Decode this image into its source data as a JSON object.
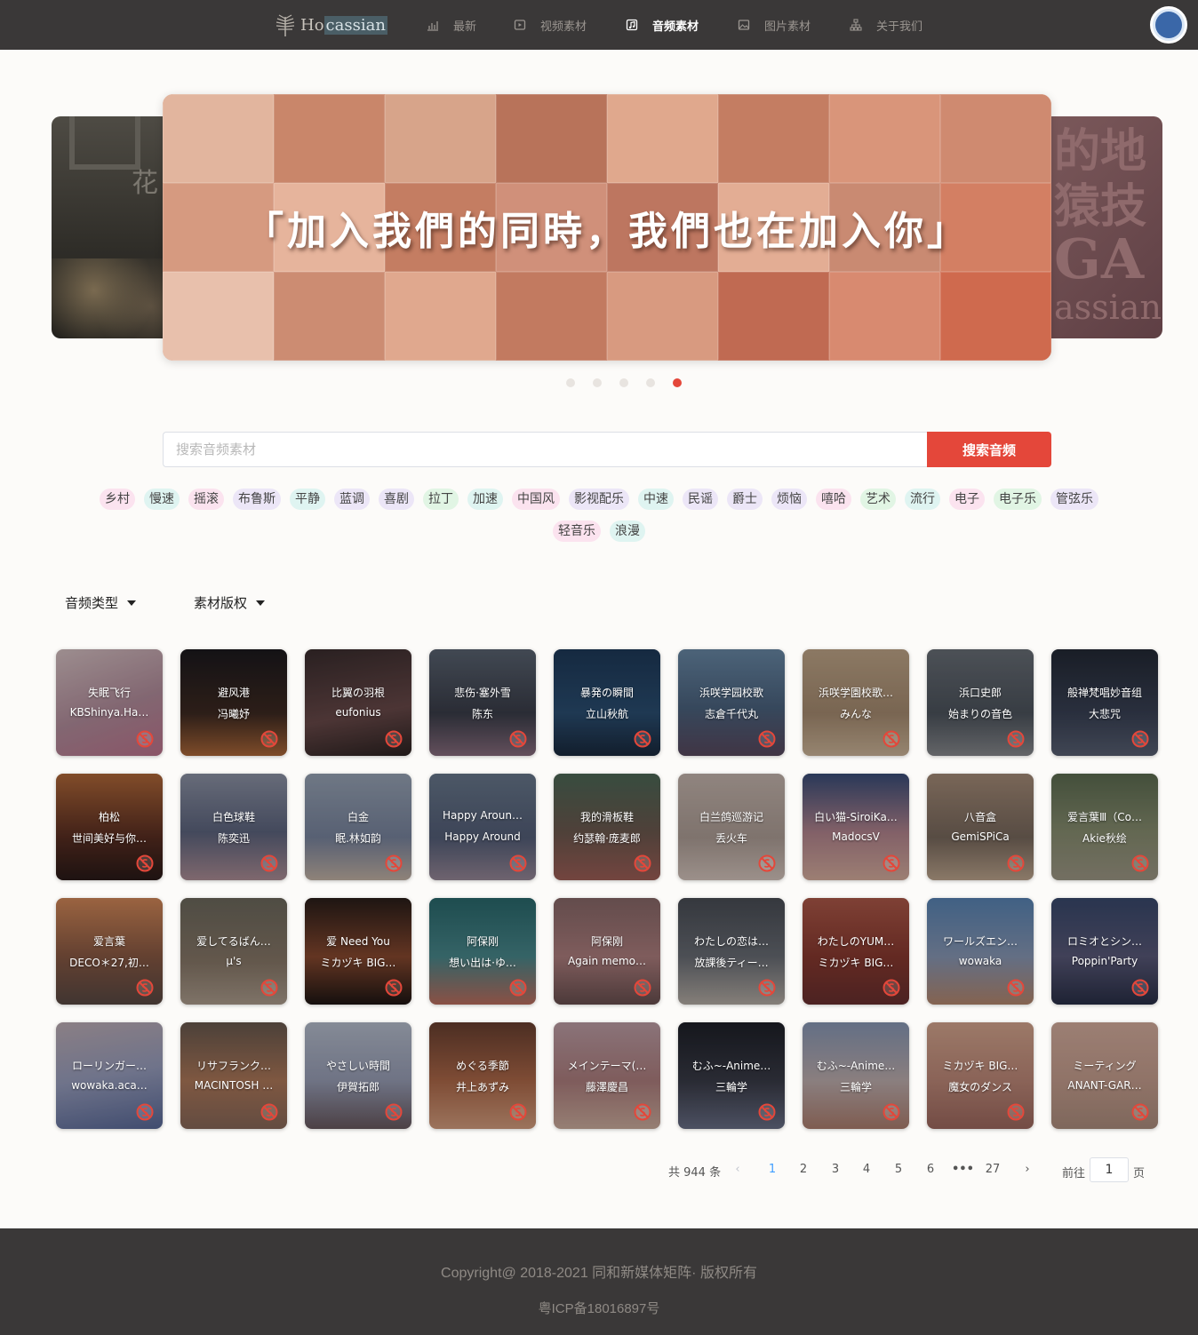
{
  "nav": {
    "logo_text_a": "Ho",
    "logo_text_b": "cassian",
    "items": [
      {
        "label": "最新",
        "icon": "bar-chart-icon"
      },
      {
        "label": "视频素材",
        "icon": "video-icon"
      },
      {
        "label": "音频素材",
        "icon": "music-icon"
      },
      {
        "label": "图片素材",
        "icon": "picture-icon"
      },
      {
        "label": "关于我们",
        "icon": "org-chart-icon"
      }
    ],
    "active_index": 2
  },
  "carousel": {
    "banner_text": "「加入我們的同時，我們也在加入你」",
    "left_slide_glyph": "花",
    "right_slide_lines": [
      "的地",
      "猿技",
      "GA",
      "assian"
    ],
    "dot_count": 5,
    "active_dot": 4
  },
  "search": {
    "placeholder": "搜索音频素材",
    "button_label": "搜索音频"
  },
  "tags": [
    {
      "label": "乡村",
      "color": "#fbe3ef"
    },
    {
      "label": "慢速",
      "color": "#dff4f1"
    },
    {
      "label": "摇滚",
      "color": "#fbe3ef"
    },
    {
      "label": "布鲁斯",
      "color": "#ece6f7"
    },
    {
      "label": "平静",
      "color": "#dff4f1"
    },
    {
      "label": "蓝调",
      "color": "#ece6f7"
    },
    {
      "label": "喜剧",
      "color": "#ece6f7"
    },
    {
      "label": "拉丁",
      "color": "#e1f5e4"
    },
    {
      "label": "加速",
      "color": "#dff4f1"
    },
    {
      "label": "中国风",
      "color": "#fbe3ef"
    },
    {
      "label": "影视配乐",
      "color": "#ece6f7"
    },
    {
      "label": "中速",
      "color": "#dff4f1"
    },
    {
      "label": "民谣",
      "color": "#ece6f7"
    },
    {
      "label": "爵士",
      "color": "#ece6f7"
    },
    {
      "label": "烦恼",
      "color": "#ece6f7"
    },
    {
      "label": "嘻哈",
      "color": "#fbe3ef"
    },
    {
      "label": "艺术",
      "color": "#e1f5e4"
    },
    {
      "label": "流行",
      "color": "#dff4f1"
    },
    {
      "label": "电子",
      "color": "#fbe3ef"
    },
    {
      "label": "电子乐",
      "color": "#e1f5e4"
    },
    {
      "label": "管弦乐",
      "color": "#ece6f7"
    },
    {
      "label": "轻音乐",
      "color": "#fbe3ef"
    },
    {
      "label": "浪漫",
      "color": "#dff4f1"
    }
  ],
  "filters": {
    "type_label": "音频类型",
    "license_label": "素材版权"
  },
  "cards": [
    {
      "title": "失眠飞行",
      "artist": "KBShinya.Ha…",
      "bg": "linear-gradient(160deg,#d9c4c6,#b58f9e 55%,#c07690)"
    },
    {
      "title": "避风港",
      "artist": "冯曦妤",
      "bg": "linear-gradient(180deg,#1c1a1e,#3e2a22 60%,#b06a3a)"
    },
    {
      "title": "比翼の羽根",
      "artist": "eufonius",
      "bg": "linear-gradient(170deg,#3a2d2e,#6a4a4a 60%,#2c2322)"
    },
    {
      "title": "悲伤·塞外雪",
      "artist": "陈东",
      "bg": "linear-gradient(180deg,#5b6573,#3b3e4a 60%,#8a6e80)"
    },
    {
      "title": "暴発の瞬間",
      "artist": "立山秋航",
      "bg": "linear-gradient(180deg,#1e3a5a,#2b4f73 60%,#1a2a3e)"
    },
    {
      "title": "浜咲学园校歌",
      "artist": "志倉千代丸",
      "bg": "linear-gradient(180deg,#6a8aa8,#4c6480 55%,#5a4a60)"
    },
    {
      "title": "浜咲学園校歌…",
      "artist": "みんな",
      "bg": "linear-gradient(180deg,#c2a88a,#a88d72 60%,#d1b99c)"
    },
    {
      "title": "浜口史郎",
      "artist": "始まりの音色",
      "bg": "linear-gradient(180deg,#6a7078,#4e555e 60%,#8a8c90)"
    },
    {
      "title": "般禅梵唱妙音组",
      "artist": "大悲咒",
      "bg": "linear-gradient(180deg,#242a36,#3a4256 60%,#5a6275)"
    },
    {
      "title": "柏松",
      "artist": "世间美好与你…",
      "bg": "linear-gradient(180deg,#b46a3a,#5a2e22 60%,#2a1a18)"
    },
    {
      "title": "白色球鞋",
      "artist": "陈奕迅",
      "bg": "linear-gradient(180deg,#8f95a8,#5e6680 55%,#b09098)"
    },
    {
      "title": "白金",
      "artist": "眠.林如韵",
      "bg": "linear-gradient(180deg,#9aa6b8,#7a86a0 60%,#c6b5a8)"
    },
    {
      "title": "Happy Aroun…",
      "artist": "Happy Around",
      "bg": "linear-gradient(180deg,#6a7a8e,#55607a 60%,#9a8a9a)"
    },
    {
      "title": "我的滑板鞋",
      "artist": "约瑟翰·庞麦郎",
      "bg": "linear-gradient(180deg,#4e6a58,#6e5a50 55%,#a06058)"
    },
    {
      "title": "白兰鸽巡游记",
      "artist": "丢火车",
      "bg": "linear-gradient(180deg,#c8b8b0,#b0a098 60%,#d8c8c0)"
    },
    {
      "title": "白い猫-SiroiKa…",
      "artist": "MadocsV",
      "bg": "linear-gradient(180deg,#3a4e7a,#b58690 55%,#d9b0a0)"
    },
    {
      "title": "八音盒",
      "artist": "GemiSPiCa",
      "bg": "linear-gradient(180deg,#a88e7a,#7a6a5e 60%,#c0a890)"
    },
    {
      "title": "爱言葉Ⅲ（Co…",
      "artist": "Akie秋绘",
      "bg": "linear-gradient(180deg,#5e6e52,#8a9072 55%,#a09a88)"
    },
    {
      "title": "爱言葉",
      "artist": "DECO＊27,初…",
      "bg": "linear-gradient(180deg,#d68a5a,#8a5a44 55%,#5a4a44)"
    },
    {
      "title": "爱してるばん…",
      "artist": "μ's",
      "bg": "linear-gradient(180deg,#6e6a5e,#8a7a6a 60%,#b0a090)"
    },
    {
      "title": "爱 Need You",
      "artist": "ミカヅキ BIG…",
      "bg": "linear-gradient(180deg,#2a1e1a,#8a4a30 55%,#1e1614)"
    },
    {
      "title": "阿保刚",
      "artist": "想い出は·ゆ…",
      "bg": "linear-gradient(180deg,#2a6a6e,#4a8a8e 55%,#c07060)"
    },
    {
      "title": "阿保刚",
      "artist": "Again memo…",
      "bg": "linear-gradient(180deg,#8a6a6a,#b08080 55%,#6a5050)"
    },
    {
      "title": "わたしの恋は…",
      "artist": "放課後ティー…",
      "bg": "linear-gradient(180deg,#4a4e56,#6a6e76 55%,#b8b0a8)"
    },
    {
      "title": "わたしのYUM…",
      "artist": "ミカヅキ BIG…",
      "bg": "linear-gradient(180deg,#b05a4a,#8a3a30 55%,#6a3030)"
    },
    {
      "title": "ワールズエン…",
      "artist": "wowaka",
      "bg": "linear-gradient(180deg,#5a86b8,#8a9ab8 55%,#b88a70)"
    },
    {
      "title": "ロミオとシン…",
      "artist": "Poppin'Party",
      "bg": "linear-gradient(180deg,#3a4a6e,#5a5a7a 55%,#2a3048)"
    },
    {
      "title": "ローリンガー…",
      "artist": "wowaka.aca…",
      "bg": "linear-gradient(170deg,#c0b0b8,#9aa0c0 50%,#5a6a9a)"
    },
    {
      "title": "リサフランク…",
      "artist": "MACINTOSH …",
      "bg": "linear-gradient(180deg,#6a5a50,#b07a5a 55%,#8a6a5a)"
    },
    {
      "title": "やさしい時間",
      "artist": "伊賀拓郎",
      "bg": "linear-gradient(180deg,#b8c0d0,#9aa0b8 55%,#6a5a60)"
    },
    {
      "title": "めぐる季節",
      "artist": "井上あずみ",
      "bg": "linear-gradient(180deg,#6a4030,#b06a4a 55%,#d8a080)"
    },
    {
      "title": "メインテーマ(…",
      "artist": "藤澤慶昌",
      "bg": "linear-gradient(180deg,#c0a0a8,#b08080 55%,#d0b0a0)"
    },
    {
      "title": "むふ~-Anime…",
      "artist": "三輪学",
      "bg": "linear-gradient(180deg,#1e2028,#3a3c48 55%,#6a7088)"
    },
    {
      "title": "むふ~-Anime…",
      "artist": "三輪学",
      "bg": "linear-gradient(180deg,#8a9ab8,#c0b0b0 55%,#b08070)"
    },
    {
      "title": "ミカヅキ BIG…",
      "artist": "魔女のダンス",
      "bg": "linear-gradient(180deg,#d8a890,#c08a7a 55%,#a06a60)"
    },
    {
      "title": "ミーティング",
      "artist": "ANANT-GAR…",
      "bg": "linear-gradient(180deg,#d8b0a0,#c8a090 55%,#b09080)"
    }
  ],
  "pagination": {
    "total_text": "共 944 条",
    "pages": [
      "1",
      "2",
      "3",
      "4",
      "5",
      "6",
      "•••",
      "27"
    ],
    "active_page": "1",
    "prev_symbol": "‹",
    "next_symbol": "›",
    "goto_label": "前往",
    "goto_value": "1",
    "goto_unit": "页"
  },
  "footer": {
    "copyright": "Copyright@ 2018-2021 同和新媒体矩阵· 版权所有",
    "icp": "粤ICP备18016897号"
  },
  "colors": {
    "accent": "#e4473a",
    "nav_bg": "#3a3838",
    "page_bg": "#fcfbf9",
    "active_page": "#409eff"
  }
}
